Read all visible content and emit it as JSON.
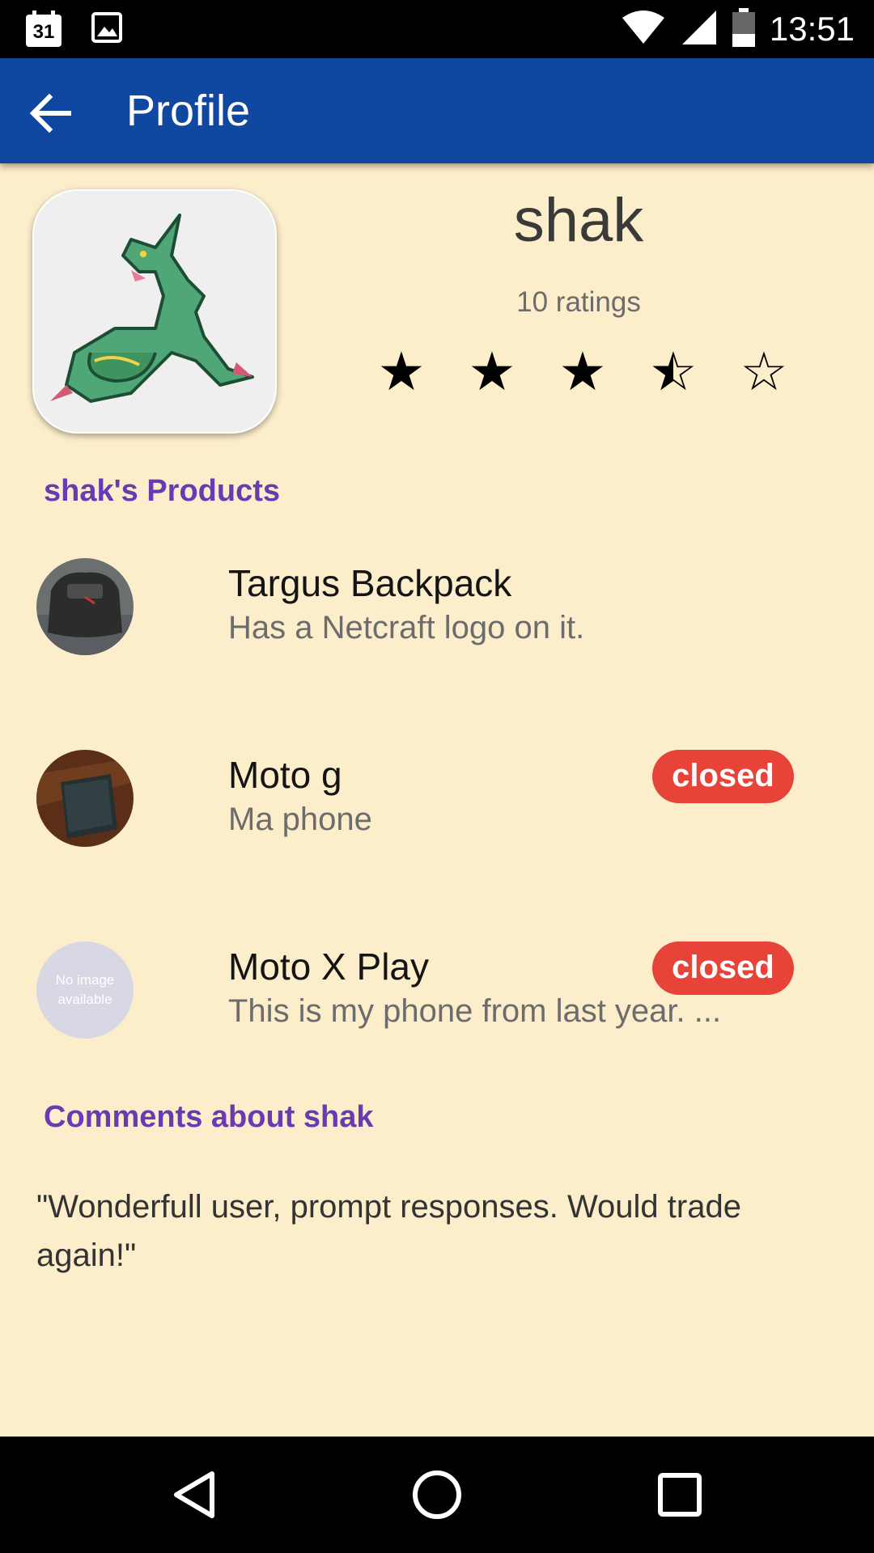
{
  "status_bar": {
    "time": "13:51",
    "calendar_day": "31"
  },
  "app_bar": {
    "title": "Profile"
  },
  "profile": {
    "username": "shak",
    "ratings_count": "10 ratings",
    "stars": [
      "filled",
      "filled",
      "filled",
      "half",
      "empty"
    ],
    "rating": 3.5
  },
  "products_section": {
    "title": "shak's Products"
  },
  "products": [
    {
      "name": "Targus Backpack",
      "description": "Has a Netcraft logo on it.",
      "badge": ""
    },
    {
      "name": "Moto g",
      "description": "Ma phone",
      "badge": "closed"
    },
    {
      "name": "Moto X Play",
      "description": "This is my phone from last year. ...",
      "badge": "closed",
      "no_image_text": "No image available"
    }
  ],
  "comments_section": {
    "title": "Comments about shak",
    "comments": [
      "\"Wonderfull user, prompt responses. Would trade again!\""
    ]
  },
  "colors": {
    "app_bar": "#0f47a1",
    "background": "#fcedcb",
    "section_title": "#6a3ab2",
    "badge": "#e84339"
  }
}
